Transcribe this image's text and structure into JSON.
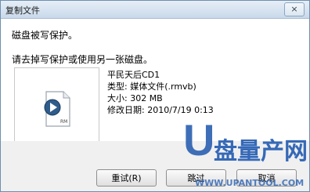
{
  "window": {
    "title": "复制文件",
    "close_glyph": "×"
  },
  "messages": {
    "line1": "磁盘被写保护。",
    "line2": "请去掉写保护或使用另一张磁盘。"
  },
  "file": {
    "name": "平民天后CD1",
    "type": "类型: 媒体文件(.rmvb)",
    "size": "大小: 302 MB",
    "modified": "修改日期: 2010/7/19 0:13",
    "icon_label": "RM"
  },
  "buttons": {
    "retry": "重试(R)",
    "skip": "跳过",
    "cancel": "取消"
  },
  "watermark": {
    "letter": "U",
    "text": "盘量产网",
    "url": "WWW.UPANTOOL.COM"
  },
  "icons": {
    "file_icon": "realmedia-file-icon",
    "close_icon": "close-icon"
  },
  "colors": {
    "accent": "#2b62b4",
    "window_border": "#6f8fae"
  }
}
